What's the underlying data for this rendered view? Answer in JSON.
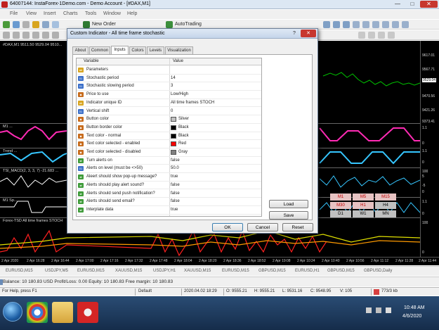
{
  "window": {
    "title": "64007144: InstaForex-1Demo.com - Demo Account - [#DAX,M1]",
    "min_glyph": "—",
    "max_glyph": "□",
    "close_glyph": "✕"
  },
  "menu": {
    "items": [
      "File",
      "View",
      "Insert",
      "Charts",
      "Tools",
      "Window",
      "Help"
    ]
  },
  "toolbar": {
    "new_order_label": "New Order",
    "autotrading_label": "AutoTrading"
  },
  "chart": {
    "symbol_title": "#DAX,M1  9511.50 9529.04 9510...",
    "pane_titles": [
      "M1 ...",
      "Trend ...",
      "TSI_MACD(2, 3, 3, 7) -21.683 ...",
      "M1 Sp...",
      "Forex-TSD All time frames STOCH"
    ],
    "price_labels": [
      "9617.01",
      "9567.71",
      "9529.04",
      "9470.56",
      "9421.26",
      "9373.41",
      "1.1",
      "0",
      "1.1",
      "0",
      "100",
      "0",
      "5",
      "-5",
      "1.1",
      "0",
      "100",
      "0"
    ],
    "timeframes": [
      "M1",
      "M5",
      "M15",
      "M30",
      "H1",
      "H4",
      "D1",
      "W1",
      "MN"
    ],
    "time_labels": [
      "2 Apr 2020",
      "2 Apr 16:28",
      "2 Apr 16:44",
      "2 Apr 17:00",
      "2 Apr 17:16",
      "2 Apr 17:32",
      "2 Apr 17:48",
      "2 Apr 18:04",
      "2 Apr 18:20",
      "2 Apr 18:36",
      "2 Apr 18:52",
      "2 Apr 19:08",
      "2 Apr 10:24",
      "2 Apr 10:40",
      "2 Apr 10:56",
      "2 Apr 11:12",
      "2 Apr 11:28",
      "2 Apr 11:44"
    ],
    "colors": {
      "background": "#000000",
      "price_line": "#00c000",
      "magenta": "#ff2bb4",
      "cyan": "#36c6ff",
      "white": "#ffffff",
      "red": "#ff2020",
      "yellow": "#e0e000",
      "orange": "#ff9a00"
    }
  },
  "chart_tabs": [
    "EURUSD,M15",
    "USDJPY,M5",
    "EURUSD,M15",
    "XAUUSD,M15",
    "USDJPY,H1",
    "XAUUSD,M15",
    "EURUSD,M15",
    "GBPUSD,M15",
    "EURUSD,H1",
    "GBPUSD,M15",
    "GBPUSD,Daily"
  ],
  "balance": {
    "text": "Balance: 10 180.83 USD   Profit/Loss: 0.00   Equity: 10 180.83   Free margin: 10 180.83"
  },
  "status": {
    "help": "For Help, press F1",
    "profile": "Default",
    "datetime": "2020.04.02 18:29",
    "open": "O: 9555.21",
    "high": "H: 9555.21",
    "low": "L: 9531.16",
    "close": "C: 9548.95",
    "volume": "V: 105",
    "traffic": "773/3 kb"
  },
  "taskbar": {
    "time": "10:48 AM",
    "date": "4/6/2020"
  },
  "dialog": {
    "title": "Custom Indicator - All time frame stochastic",
    "help_glyph": "?",
    "close_glyph": "✕",
    "tabs": [
      "About",
      "Common",
      "Inputs",
      "Colors",
      "Levels",
      "Visualization"
    ],
    "active_tab": "Inputs",
    "columns": {
      "variable": "Variable",
      "value": "Value"
    },
    "params": [
      {
        "icon": "str",
        "name": "Parameters",
        "value": ""
      },
      {
        "icon": "num",
        "name": "Stochastic period",
        "value": "14"
      },
      {
        "icon": "num",
        "name": "Stochastic slowing period",
        "value": "3"
      },
      {
        "icon": "color",
        "name": "Price to use",
        "value": "Low/High"
      },
      {
        "icon": "str",
        "name": "Indicator unique ID",
        "value": "All time frames STOCH"
      },
      {
        "icon": "num",
        "name": "Vertical shift",
        "value": "0"
      },
      {
        "icon": "color",
        "name": "Button color",
        "value": "Silver",
        "swatch": "#c0c0c0"
      },
      {
        "icon": "color",
        "name": "Button border color",
        "value": "Black",
        "swatch": "#000000"
      },
      {
        "icon": "color",
        "name": "Text color - normal",
        "value": "Black",
        "swatch": "#000000"
      },
      {
        "icon": "color",
        "name": "Text color selected - enabled",
        "value": "Red",
        "swatch": "#ff0000"
      },
      {
        "icon": "color",
        "name": "Text color selected - disabled",
        "value": "Gray",
        "swatch": "#808080"
      },
      {
        "icon": "bool",
        "name": "Turn alerts on",
        "value": "false"
      },
      {
        "icon": "num",
        "name": "Alerts on level (must be <>50)",
        "value": "50.0"
      },
      {
        "icon": "bool",
        "name": "Aleert should show pop-up message?",
        "value": "true"
      },
      {
        "icon": "bool",
        "name": "Alerts should play alert sound?",
        "value": "false"
      },
      {
        "icon": "bool",
        "name": "Alerts should send push notification?",
        "value": "false"
      },
      {
        "icon": "bool",
        "name": "Alerts should send email?",
        "value": "false"
      },
      {
        "icon": "bool",
        "name": "Interplate data",
        "value": "true"
      }
    ],
    "load_label": "Load",
    "save_label": "Save",
    "ok_label": "OK",
    "cancel_label": "Cancel",
    "reset_label": "Reset"
  }
}
